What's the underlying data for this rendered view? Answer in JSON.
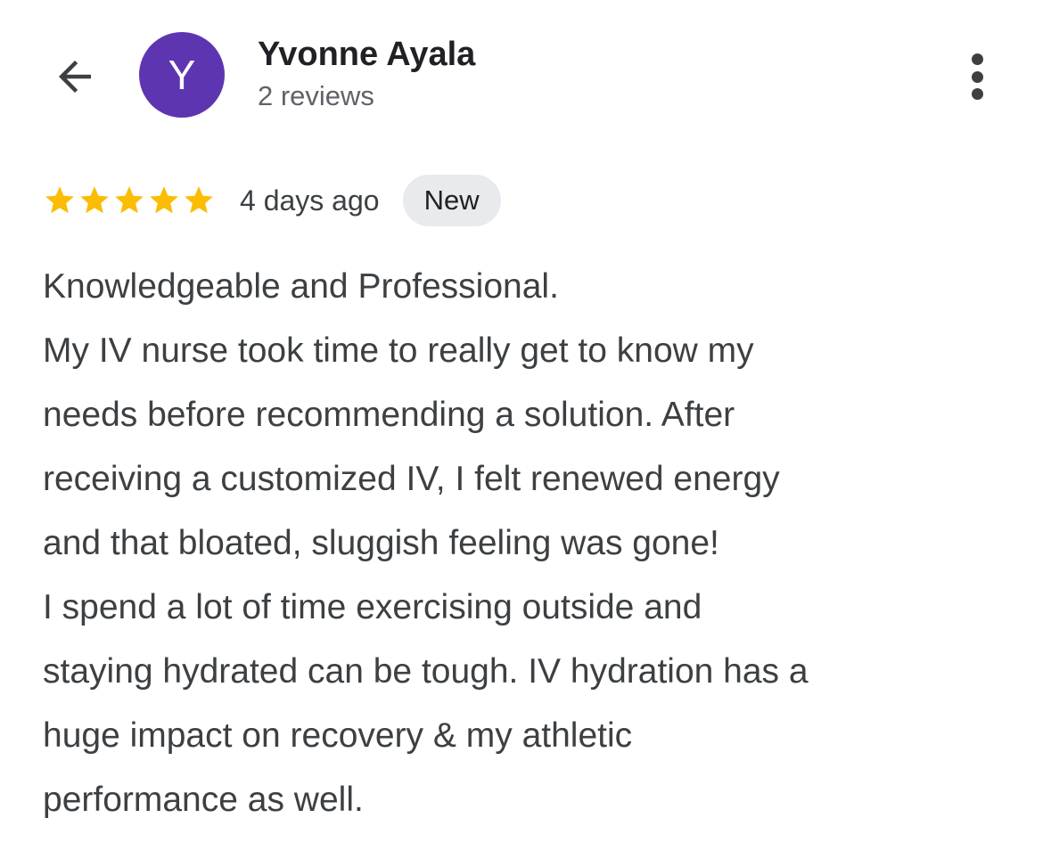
{
  "header": {
    "back_icon": "arrow-left-icon",
    "avatar_letter": "Y",
    "avatar_color": "#5e35b1",
    "name": "Yvonne Ayala",
    "review_count": "2 reviews",
    "more_icon": "more-vert-icon"
  },
  "review": {
    "rating": 5,
    "rating_max": 5,
    "star_color": "#fbbc04",
    "date": "4 days ago",
    "badge": "New",
    "lines": [
      "Knowledgeable and Professional.",
      "My IV nurse took time to really get to know my",
      "needs before recommending a solution. After",
      "receiving a customized IV, I felt renewed energy",
      "and that bloated, sluggish feeling was gone!",
      "I spend a lot of time exercising outside and",
      "staying hydrated can be tough. IV hydration has a",
      "huge impact on recovery & my athletic",
      "performance as well."
    ]
  }
}
